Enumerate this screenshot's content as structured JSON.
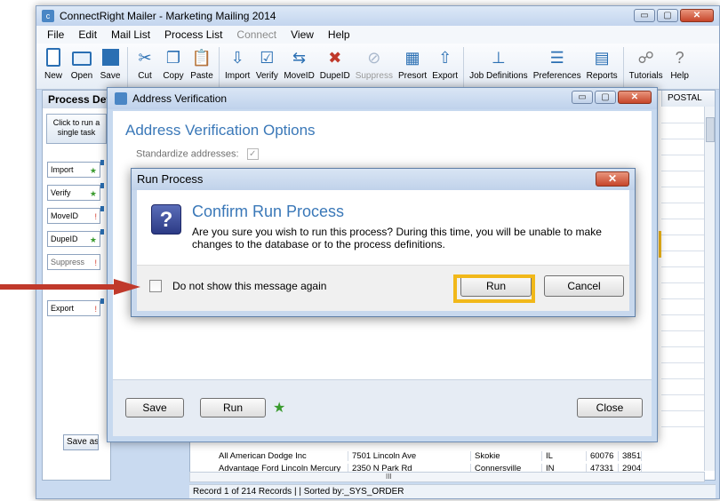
{
  "app": {
    "title": "ConnectRight Mailer - Marketing Mailing 2014",
    "window_buttons": {
      "minimize": "▭",
      "maximize": "▢",
      "close": "✕"
    }
  },
  "menu": {
    "file": "File",
    "edit": "Edit",
    "mail_list": "Mail List",
    "process_list": "Process List",
    "connect": "Connect",
    "view": "View",
    "help": "Help"
  },
  "toolbar": {
    "new": "New",
    "open": "Open",
    "save": "Save",
    "cut": "Cut",
    "copy": "Copy",
    "paste": "Paste",
    "import": "Import",
    "verify": "Verify",
    "moveid": "MoveID",
    "dupeid": "DupeID",
    "suppress": "Suppress",
    "presort": "Presort",
    "export": "Export",
    "job_definitions": "Job Definitions",
    "preferences": "Preferences",
    "reports": "Reports",
    "tutorials": "Tutorials",
    "help": "Help"
  },
  "process_panel": {
    "heading": "Process Def",
    "click_to_run": "Click to run a single task",
    "tasks": [
      {
        "label": "Import",
        "status": "★"
      },
      {
        "label": "Verify",
        "status": "★"
      },
      {
        "label": "MoveID",
        "status": "!"
      },
      {
        "label": "DupeID",
        "status": "★"
      },
      {
        "label": "Suppress",
        "status": "!"
      },
      {
        "label": "Export",
        "status": "!"
      }
    ],
    "save_as": "Save as"
  },
  "grid": {
    "column_header": "POSTAL",
    "rows": [
      {
        "name": "All American Dodge Inc",
        "address": "7501 Lincoln Ave",
        "city": "Skokie",
        "state": "IL",
        "zip": "60076",
        "plus4": "3851"
      },
      {
        "name": "Advantage Ford Lincoln Mercury",
        "address": "2350 N Park Rd",
        "city": "Connersville",
        "state": "IN",
        "zip": "47331",
        "plus4": "2904"
      }
    ],
    "hscroll_label": "III",
    "status": "Record 1 of 214 Records  |  | Sorted by:_SYS_ORDER"
  },
  "av_dialog": {
    "title": "Address Verification",
    "heading": "Address Verification Options",
    "standardize_label": "Standardize addresses:",
    "standardize_check": "✓",
    "save": "Save",
    "run": "Run",
    "close": "Close"
  },
  "run_dialog": {
    "title": "Run Process",
    "close_x": "✕",
    "icon_glyph": "?",
    "heading": "Confirm Run Process",
    "message": "Are you sure you wish to run this process?  During this time, you will be unable to make changes to the database or to the process definitions.",
    "checkbox_label": "Do not show this message again",
    "run": "Run",
    "cancel": "Cancel"
  },
  "colors": {
    "highlight": "#f1b81a",
    "arrow": "#c0392b",
    "accent": "#3a78b8"
  }
}
